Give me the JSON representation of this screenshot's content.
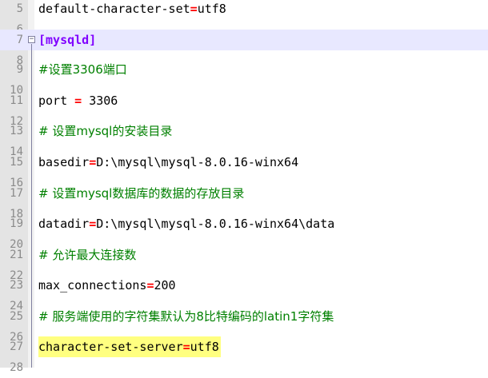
{
  "editor": {
    "lines": [
      {
        "num": "5",
        "key": "default-character-set",
        "op": "=",
        "value": "utf8",
        "kind": "kv"
      },
      {
        "num": "6",
        "text": "",
        "kind": "blank"
      },
      {
        "num": "7",
        "text": "[mysqld]",
        "kind": "section"
      },
      {
        "num": "8",
        "text": "",
        "kind": "blank"
      },
      {
        "num": "9",
        "text": "#设置3306端口",
        "kind": "comment"
      },
      {
        "num": "10",
        "text": "",
        "kind": "blank"
      },
      {
        "num": "11",
        "key": "port ",
        "op": "=",
        "value": " 3306",
        "kind": "kv"
      },
      {
        "num": "12",
        "text": "",
        "kind": "blank"
      },
      {
        "num": "13",
        "text": "# 设置mysql的安装目录",
        "kind": "comment"
      },
      {
        "num": "14",
        "text": "",
        "kind": "blank"
      },
      {
        "num": "15",
        "key": "basedir",
        "op": "=",
        "value": "D:\\mysql\\mysql-8.0.16-winx64",
        "kind": "kv"
      },
      {
        "num": "16",
        "text": "",
        "kind": "blank"
      },
      {
        "num": "17",
        "text": "# 设置mysql数据库的数据的存放目录",
        "kind": "comment"
      },
      {
        "num": "18",
        "text": "",
        "kind": "blank"
      },
      {
        "num": "19",
        "key": "datadir",
        "op": "=",
        "value": "D:\\mysql\\mysql-8.0.16-winx64\\data",
        "kind": "kv"
      },
      {
        "num": "20",
        "text": "",
        "kind": "blank"
      },
      {
        "num": "21",
        "text": "# 允许最大连接数",
        "kind": "comment"
      },
      {
        "num": "22",
        "text": "",
        "kind": "blank"
      },
      {
        "num": "23",
        "key": "max_connections",
        "op": "=",
        "value": "200",
        "kind": "kv"
      },
      {
        "num": "24",
        "text": "",
        "kind": "blank"
      },
      {
        "num": "25",
        "text": "# 服务端使用的字符集默认为8比特编码的latin1字符集",
        "kind": "comment"
      },
      {
        "num": "26",
        "text": "",
        "kind": "blank"
      },
      {
        "num": "27",
        "key": "character-set-server",
        "op": "=",
        "value": "utf8",
        "kind": "kv"
      },
      {
        "num": "28",
        "text": "",
        "kind": "blank"
      }
    ],
    "fold_icon": "minus-box-icon",
    "colors": {
      "operator": "#ff0000",
      "comment": "#008000",
      "section": "#8000ff",
      "highlight": "#ffff80",
      "current_line": "#e8e8ff"
    }
  }
}
